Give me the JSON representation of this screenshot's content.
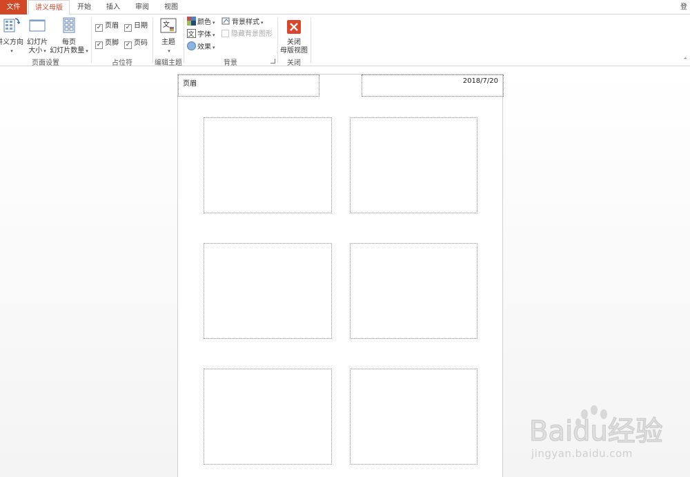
{
  "tabs": {
    "file": "文件",
    "handout_master": "讲义母版",
    "home": "开始",
    "insert": "插入",
    "review": "审阅",
    "view": "视图"
  },
  "signin": "登录",
  "ribbon": {
    "page_setup": {
      "label": "页面设置",
      "orientation": "讲义方向",
      "slide_size_l1": "幻灯片",
      "slide_size_l2": "大小",
      "slides_per_page_l1": "每页",
      "slides_per_page_l2": "幻灯片数量"
    },
    "placeholders": {
      "label": "占位符",
      "header": "页眉",
      "date": "日期",
      "footer": "页脚",
      "page_number": "页码",
      "header_checked": true,
      "date_checked": true,
      "footer_checked": true,
      "page_number_checked": true
    },
    "edit_theme": {
      "label": "编辑主题",
      "themes": "主题"
    },
    "background": {
      "label": "背景",
      "colors": "颜色",
      "fonts": "字体",
      "effects": "效果",
      "background_styles": "背景样式",
      "hide_background_graphics": "隐藏背景图形"
    },
    "close": {
      "label": "关闭",
      "close_master_l1": "关闭",
      "close_master_l2": "母版视图"
    }
  },
  "handout": {
    "header_text": "页眉",
    "date_text": "2018/7/20"
  },
  "watermark": {
    "brand": "Baidu经验",
    "url": "jingyan.baidu.com"
  },
  "colors": {
    "accent": "#d24726",
    "close_button": "#d9462b"
  }
}
